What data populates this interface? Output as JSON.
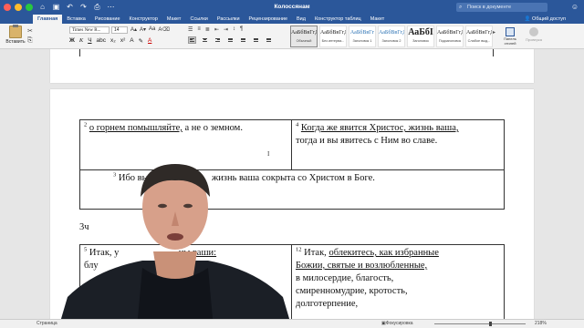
{
  "titlebar": {
    "title": "Колоссянам",
    "search_placeholder": "Поиск в документе",
    "traffic_colors": [
      "#fe5f57",
      "#febc2e",
      "#28c840"
    ]
  },
  "tabs": [
    {
      "label": "Главная",
      "active": true
    },
    {
      "label": "Вставка"
    },
    {
      "label": "Рисование"
    },
    {
      "label": "Конструктор"
    },
    {
      "label": "Макет"
    },
    {
      "label": "Ссылки"
    },
    {
      "label": "Рассылки"
    },
    {
      "label": "Рецензирование"
    },
    {
      "label": "Вид"
    },
    {
      "label": "Конструктор таблиц",
      "context": true
    },
    {
      "label": "Макет",
      "context": true
    }
  ],
  "share_label": "Общий доступ",
  "ribbon": {
    "paste_label": "Вставить",
    "font_name": "Times New R...",
    "font_size": "14",
    "styles": [
      {
        "sample": "АаБбВвГгДд",
        "name": "Обычный",
        "selected": true
      },
      {
        "sample": "АаБбВвГгДд",
        "name": "Без интерва..."
      },
      {
        "sample": "АаБбВвГг",
        "name": "Заголовок 1",
        "blue": true
      },
      {
        "sample": "АаБбВвГгД",
        "name": "Заголовок 2",
        "blue": true
      },
      {
        "sample": "АаБбI",
        "name": "Заголовок",
        "big": true
      },
      {
        "sample": "АаБбВвГгД",
        "name": "Подзаголовок"
      },
      {
        "sample": "АаБбВвГгДд",
        "name": "Слабое выд..."
      }
    ],
    "styles_panel_label": "Панель стилей",
    "record_label": "Проверка"
  },
  "document": {
    "cell_left_num": "2",
    "cell_left_text_ul": "о горнем помышляйте,",
    "cell_left_text": " а не о земном.",
    "cell_right_num": "4",
    "cell_right_text_ul": "Когда же явится Христос, жизнь ваша,",
    "cell_right_text": "тогда и вы явитесь с Ним во славе.",
    "merged_num": "3",
    "merged_text_a": "Ибо вы",
    "merged_text_b": "жизнь ваша сокрыта со Христом в Боге.",
    "heading": "3ч",
    "cell_left2_num": "5",
    "cell_left2_text_a": "Итак, у",
    "cell_left2_text_b": "ны ваши:",
    "cell_left2_line2": "блу",
    "cell_right2_num": "12",
    "cell_right2_text_a": "Итак, ",
    "cell_right2_text_ul": "облекитесь, как избранные",
    "cell_right2_line2": "Божии, святые и возлюбленные,",
    "cell_right2_line3": "в милосердие, благость,",
    "cell_right2_line4": "смиренномудрие, кротость,",
    "cell_right2_line5": "долготерпение,"
  },
  "status": {
    "page": "Страница",
    "focus": "Фокусировка",
    "zoom_percent": "218%",
    "zoom_fraction": 0.62
  }
}
